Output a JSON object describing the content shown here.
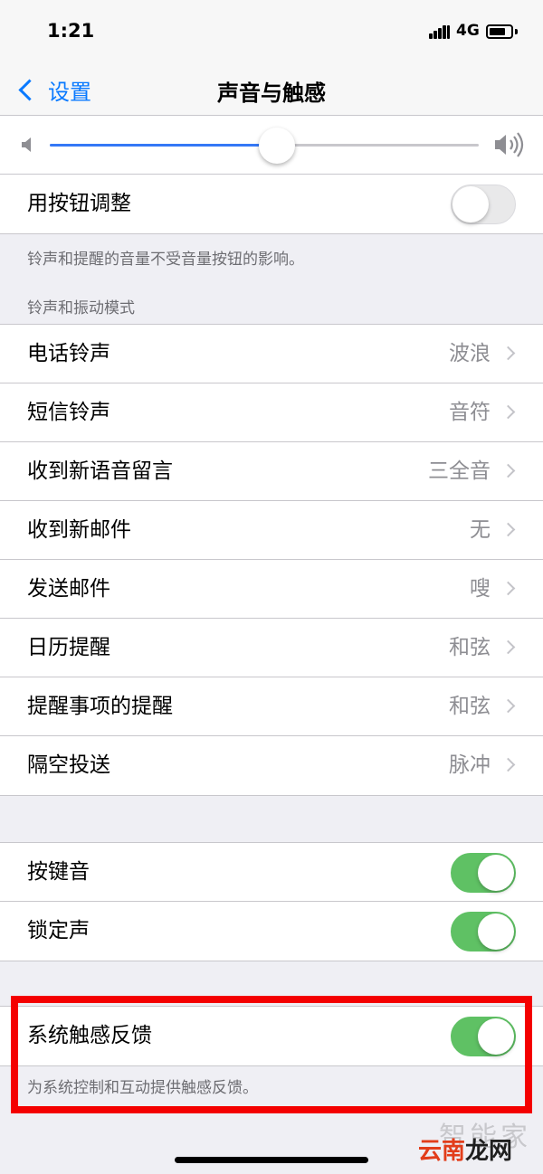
{
  "status_bar": {
    "time": "1:21",
    "network": "4G"
  },
  "nav": {
    "back_label": "设置",
    "title": "声音与触感"
  },
  "volume": {
    "level": 0.53
  },
  "button_adjust": {
    "label": "用按钮调整",
    "on": false
  },
  "ringer_note": "铃声和提醒的音量不受音量按钮的影响。",
  "ringtone_section_header": "铃声和振动模式",
  "sound_rows": [
    {
      "label": "电话铃声",
      "value": "波浪"
    },
    {
      "label": "短信铃声",
      "value": "音符"
    },
    {
      "label": "收到新语音留言",
      "value": "三全音"
    },
    {
      "label": "收到新邮件",
      "value": "无"
    },
    {
      "label": "发送邮件",
      "value": "嗖"
    },
    {
      "label": "日历提醒",
      "value": "和弦"
    },
    {
      "label": "提醒事项的提醒",
      "value": "和弦"
    },
    {
      "label": "隔空投送",
      "value": "脉冲"
    }
  ],
  "toggles": [
    {
      "label": "按键音",
      "on": true
    },
    {
      "label": "锁定声",
      "on": true
    }
  ],
  "haptics": {
    "label": "系统触感反馈",
    "on": true,
    "note": "为系统控制和互动提供触感反馈。"
  },
  "watermark": {
    "top": "智能家",
    "text_a": "云南",
    "text_b": "龙网"
  },
  "colors": {
    "accent": "#0a7aff",
    "toggle_on": "#5fc164",
    "highlight": "#f40000",
    "slider_fill": "#3478f6"
  },
  "icons": [
    "chevron-left-icon",
    "speaker-low-icon",
    "speaker-high-icon",
    "chevron-right-icon",
    "signal-icon",
    "battery-icon"
  ]
}
